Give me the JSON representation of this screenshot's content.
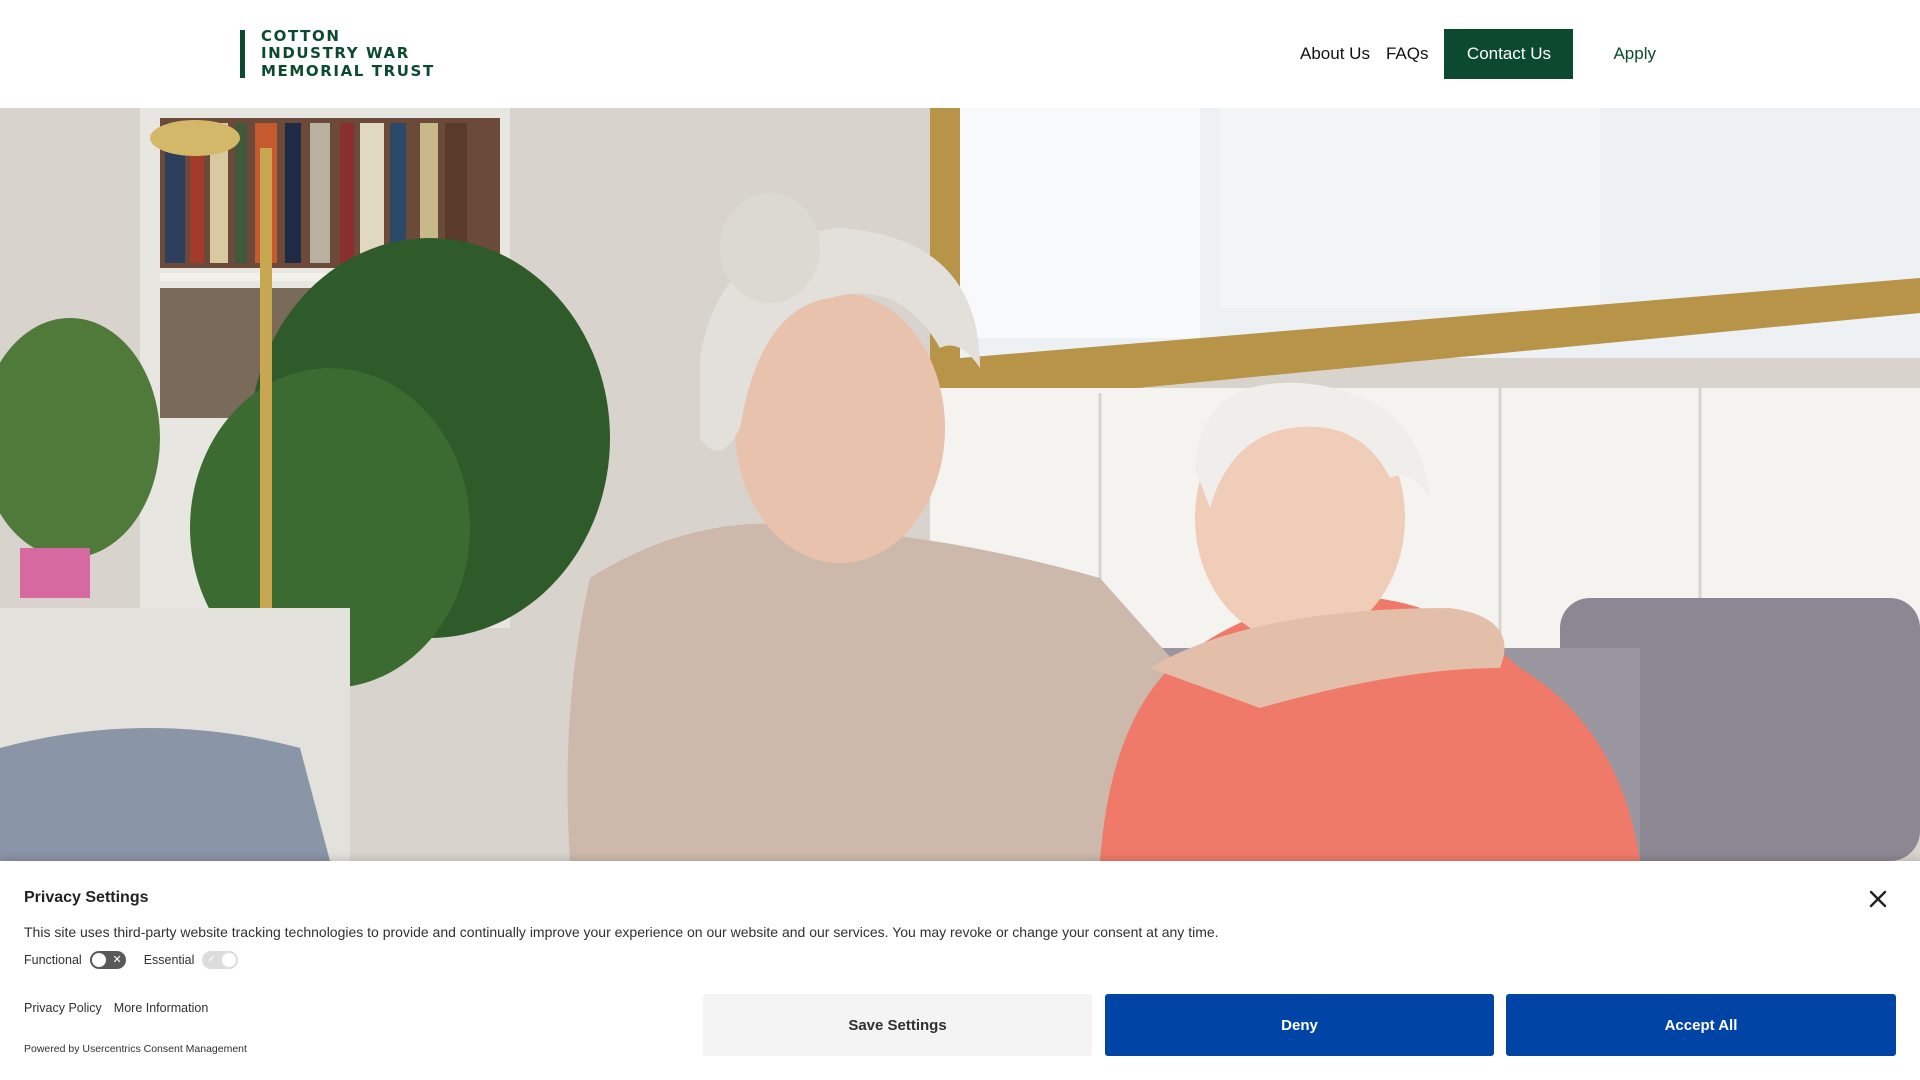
{
  "header": {
    "logo": {
      "line1": "COTTON",
      "line2": "INDUSTRY WAR",
      "line3": "MEMORIAL TRUST"
    },
    "nav": {
      "about": "About Us",
      "faqs": "FAQs",
      "contact": "Contact Us",
      "apply": "Apply"
    }
  },
  "colors": {
    "brand_green": "#0b4a2e",
    "consent_blue": "#0045a5"
  },
  "hero": {
    "image_icon": "hero-photo"
  },
  "consent": {
    "title": "Privacy Settings",
    "description": "This site uses third-party website tracking technologies to provide and continually improve your experience on our website and our services. You may revoke or change your consent at any time.",
    "toggles": [
      {
        "label": "Functional",
        "state": "off"
      },
      {
        "label": "Essential",
        "state": "on-disabled"
      }
    ],
    "links": {
      "privacy_policy": "Privacy Policy",
      "more_info": "More Information"
    },
    "powered_by": "Powered by Usercentrics Consent Management",
    "buttons": {
      "save": "Save Settings",
      "deny": "Deny",
      "accept": "Accept All"
    }
  }
}
